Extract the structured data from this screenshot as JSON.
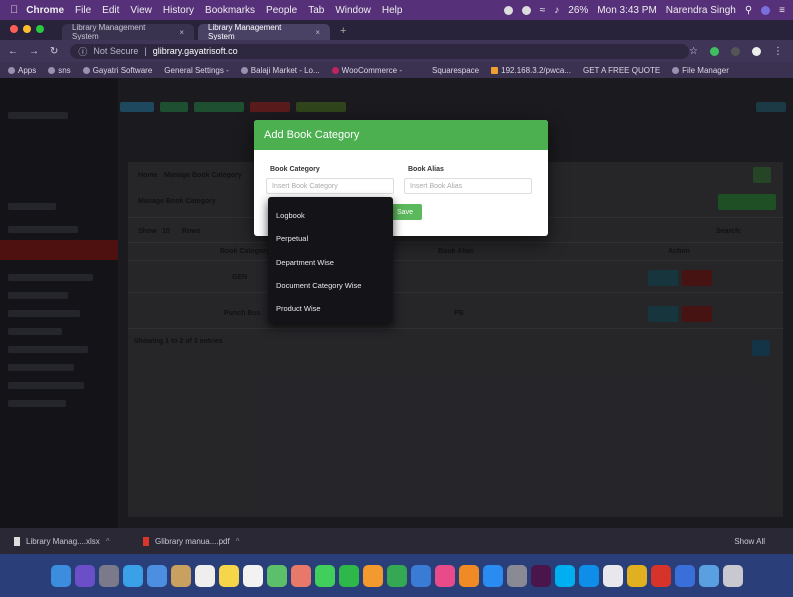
{
  "menubar": {
    "app": "Chrome",
    "items": [
      "File",
      "Edit",
      "View",
      "History",
      "Bookmarks",
      "People",
      "Tab",
      "Window",
      "Help"
    ],
    "battery": "26%",
    "clock": "Mon 3:43 PM",
    "user": "Narendra Singh"
  },
  "tabs": [
    {
      "title": "Library Management System"
    },
    {
      "title": "Library Management System"
    }
  ],
  "address": {
    "security": "Not Secure",
    "url": "glibrary.gayatrisoft.co"
  },
  "bookmarks": [
    "Apps",
    "sns",
    "Gayatri Software",
    "General Settings -",
    "Balaji Market - Lo...",
    "WooCommerce -",
    "Squarespace",
    "192.168.3.2/pwca...",
    "GET A FREE QUOTE",
    "File Manager"
  ],
  "colors": {
    "modal_header": "#4caf50",
    "save_button": "#5cb85c",
    "menubar": "#57307a",
    "dock": "#2a3f7a"
  },
  "modal": {
    "title": "Add Book Category",
    "category_label": "Book Category",
    "category_placeholder": "Insert Book Category",
    "alias_label": "Book Alias",
    "alias_placeholder": "Insert Book Alias",
    "save_label": "Save"
  },
  "autocomplete": {
    "options": [
      "Logbook",
      "Perpetual",
      "Department Wise",
      "Document Category Wise",
      "Product Wise"
    ]
  },
  "background_page": {
    "breadcrumb_home": "Home",
    "breadcrumb_current": "Manage Book Category",
    "panel_title": "Manage Book Category",
    "show_label": "Show",
    "entries_value": "10",
    "rows_label": "Rows",
    "search_label": "Search:",
    "columns": [
      "Book Category",
      "Book Alias",
      "Action"
    ],
    "rows": [
      {
        "category": "GEN",
        "alias": ""
      },
      {
        "category": "Punch Bus",
        "alias": "PB"
      }
    ],
    "footer": "Showing 1 to 2 of 2 entries"
  },
  "downloads": [
    {
      "name": "Library Manag....xlsx",
      "icon": "file-icon"
    },
    {
      "name": "Glibrary manua....pdf",
      "icon": "pdf-icon"
    }
  ],
  "downloads_show_all": "Show All"
}
